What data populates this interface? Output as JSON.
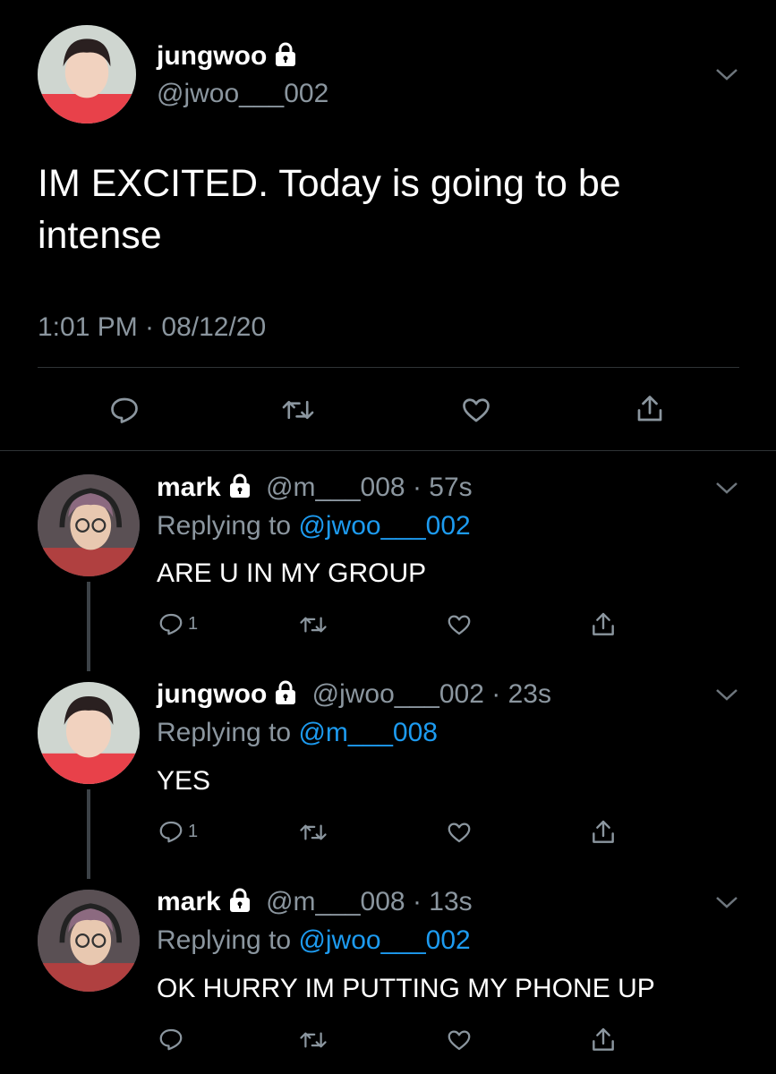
{
  "main_tweet": {
    "display_name": "jungwoo",
    "handle": "@jwoo___002",
    "text": "IM EXCITED. Today is going to be intense",
    "timestamp": "1:01 PM · 08/12/20"
  },
  "replies": [
    {
      "display_name": "mark",
      "handle": "@m___008",
      "time": "· 57s",
      "replying_label": "Replying to",
      "replying_to": "@jwoo___002",
      "text": "ARE U IN MY GROUP",
      "reply_count": "1"
    },
    {
      "display_name": "jungwoo",
      "handle": "@jwoo___002",
      "time": "· 23s",
      "replying_label": "Replying to",
      "replying_to": "@m___008",
      "text": "YES",
      "reply_count": "1"
    },
    {
      "display_name": "mark",
      "handle": "@m___008",
      "time": "· 13s",
      "replying_label": "Replying to",
      "replying_to": "@jwoo___002",
      "text": "OK HURRY IM PUTTING MY PHONE UP",
      "reply_count": ""
    }
  ],
  "colors": {
    "background": "#000000",
    "text": "#ffffff",
    "secondary": "#8b969f",
    "link": "#1d9bf0"
  },
  "icons": [
    "lock-icon",
    "chevron-down-icon",
    "reply-icon",
    "retweet-icon",
    "like-icon",
    "share-icon"
  ]
}
